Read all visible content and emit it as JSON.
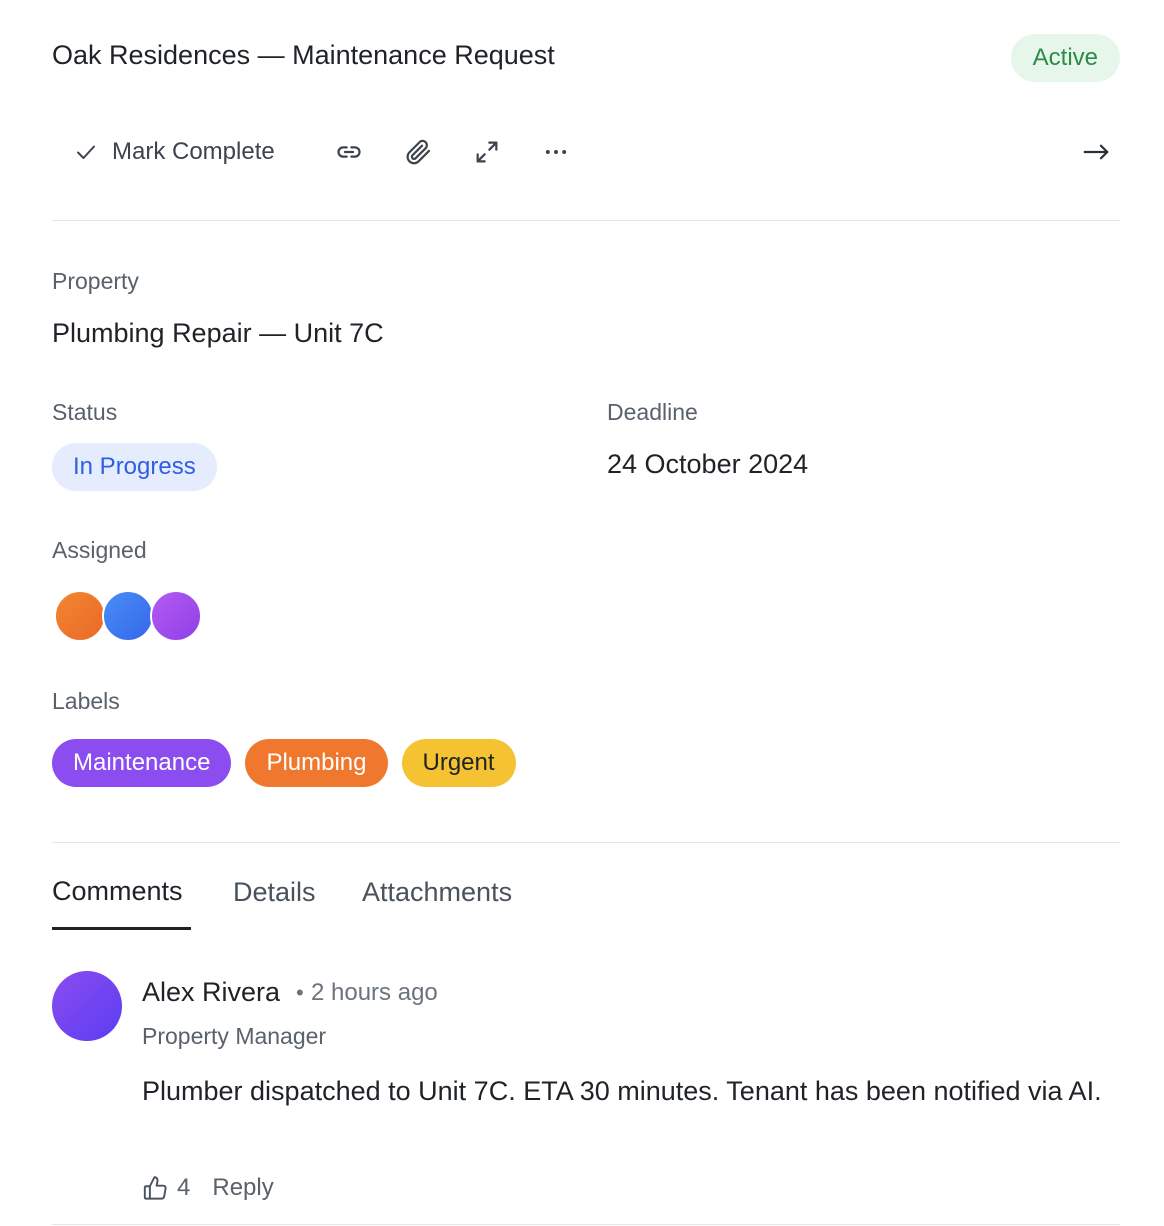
{
  "header": {
    "title": "Oak Residences — Maintenance Request",
    "status_badge": "Active",
    "status_badge_color": "#2f8a48"
  },
  "toolbar": {
    "complete_label": "Mark Complete",
    "icons": [
      "check-icon",
      "link-icon",
      "paperclip-icon",
      "expand-icon",
      "more-icon",
      "arrow-right-icon"
    ]
  },
  "property": {
    "label": "Property",
    "value": "Plumbing Repair — Unit 7C"
  },
  "status": {
    "label": "Status",
    "value": "In Progress",
    "color": "#2f5fe0"
  },
  "deadline": {
    "label": "Deadline",
    "value": "24 October 2024"
  },
  "assigned": {
    "label": "Assigned",
    "avatar_colors": [
      "#f07a2c",
      "#3d7cf2",
      "#a64cf0"
    ]
  },
  "labels": {
    "label": "Labels",
    "items": [
      {
        "text": "Maintenance",
        "bg": "#8b4cf0",
        "fg": "#ffffff"
      },
      {
        "text": "Plumbing",
        "bg": "#f0782e",
        "fg": "#ffffff"
      },
      {
        "text": "Urgent",
        "bg": "#f5c331",
        "fg": "#1f2328"
      }
    ]
  },
  "tabs": [
    {
      "label": "Comments",
      "active": true
    },
    {
      "label": "Details",
      "active": false
    },
    {
      "label": "Attachments",
      "active": false
    }
  ],
  "comment": {
    "author": "Alex Rivera",
    "separator": "•",
    "time": "2 hours ago",
    "role": "Property Manager",
    "body": "Plumber dispatched to Unit 7C. ETA 30 minutes. Tenant has been notified via AI.",
    "likes": "4",
    "reply_label": "Reply"
  }
}
